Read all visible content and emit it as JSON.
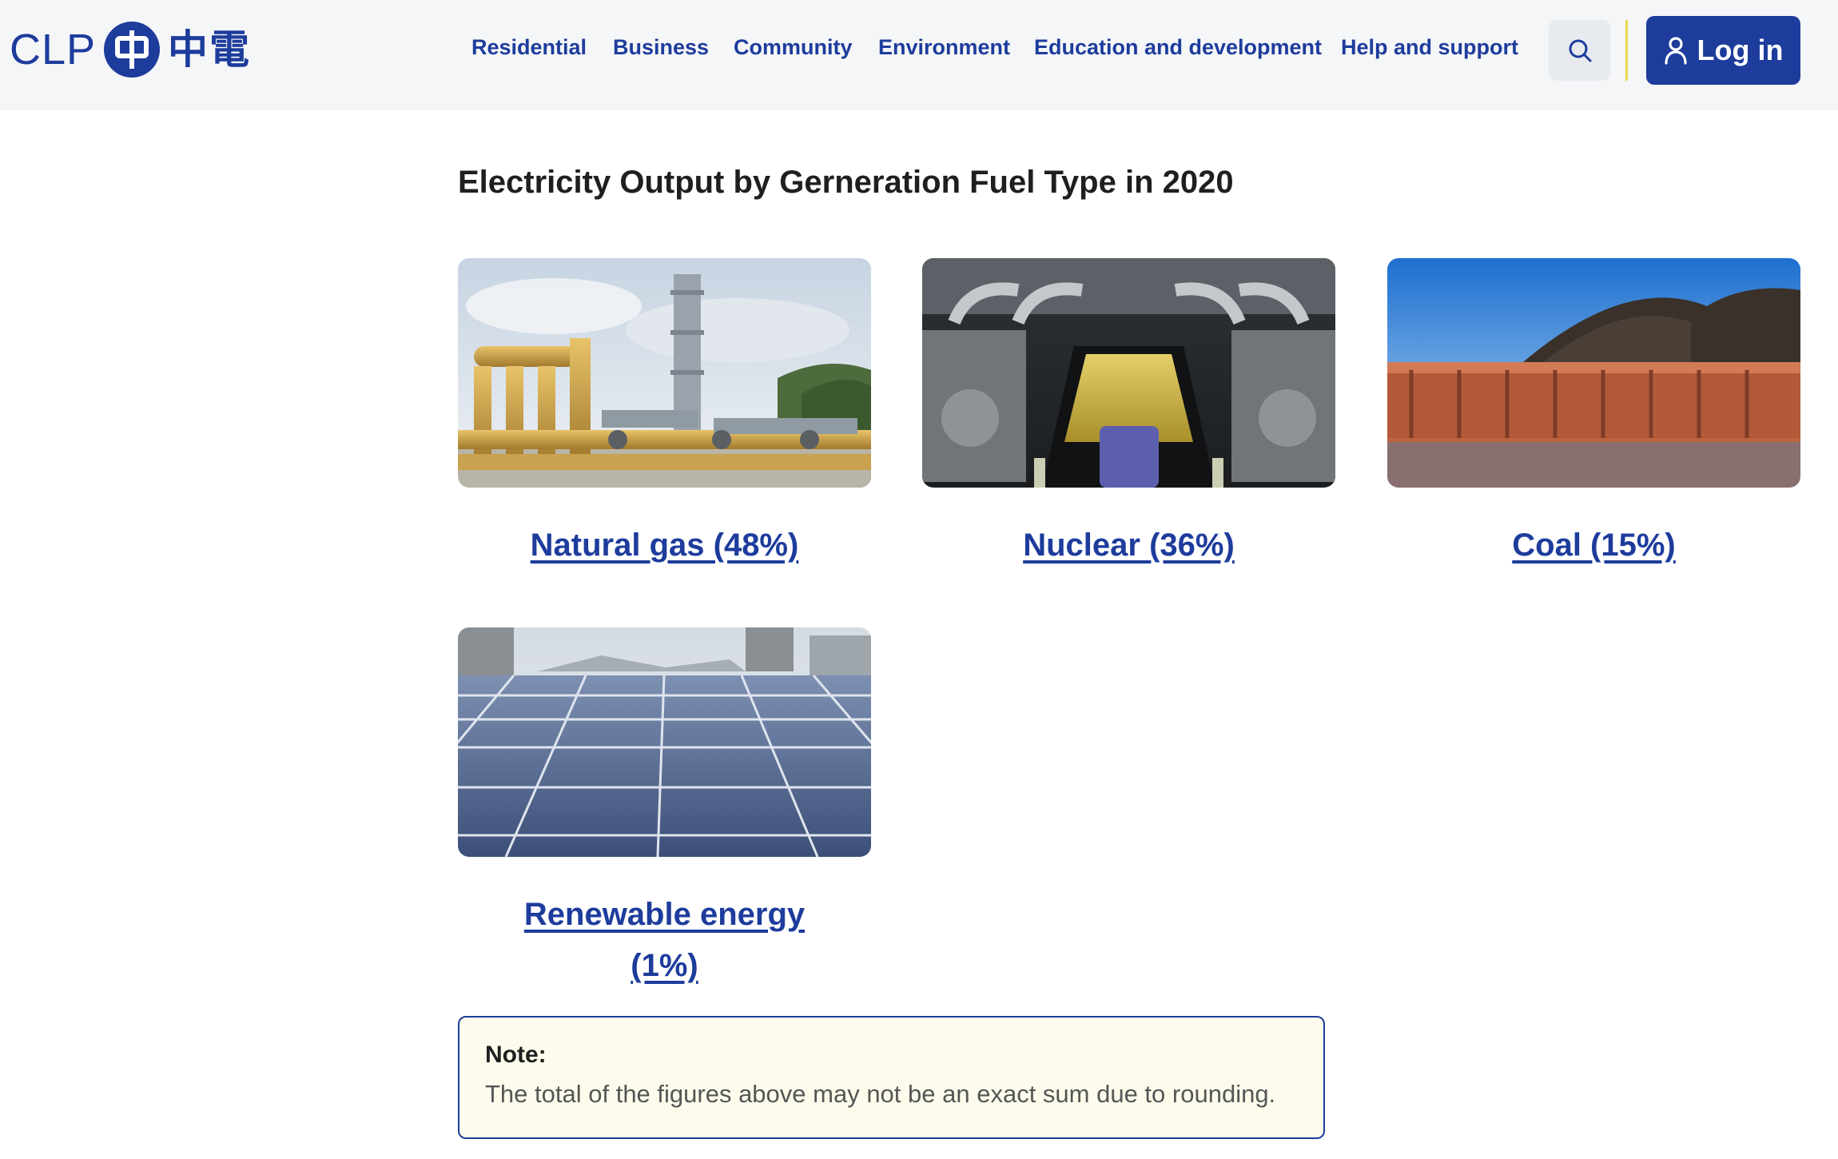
{
  "header": {
    "logo_text": "CLP",
    "logo_zh": "中電",
    "nav": [
      {
        "label": "Residential"
      },
      {
        "label": "Business"
      },
      {
        "label": "Community"
      },
      {
        "label": "Environment"
      },
      {
        "label": "Education and development"
      },
      {
        "label": "Help and support"
      }
    ],
    "search_icon": "search-icon",
    "login_label": "Log in",
    "login_icon": "user-icon"
  },
  "main": {
    "title": "Electricity Output by Gerneration Fuel Type in 2020",
    "cards": [
      {
        "label": "Natural gas (48%)",
        "percent": 48,
        "image": "gas-pipeline-plant"
      },
      {
        "label": "Nuclear (36%)",
        "percent": 36,
        "image": "nuclear-turbine-hall"
      },
      {
        "label": "Coal (15%)",
        "percent": 15,
        "image": "coal-barge"
      },
      {
        "label_line1": "Renewable energy",
        "label_line2": "(1%)",
        "percent": 1,
        "image": "solar-panels"
      }
    ],
    "note": {
      "title": "Note:",
      "text": "The total of the figures above may not be an exact sum due to rounding."
    }
  },
  "colors": {
    "brand": "#1d3c9c",
    "header_bg": "#f5f6f8",
    "note_bg": "#fdfcec",
    "accent_divider": "#e8d84a"
  }
}
